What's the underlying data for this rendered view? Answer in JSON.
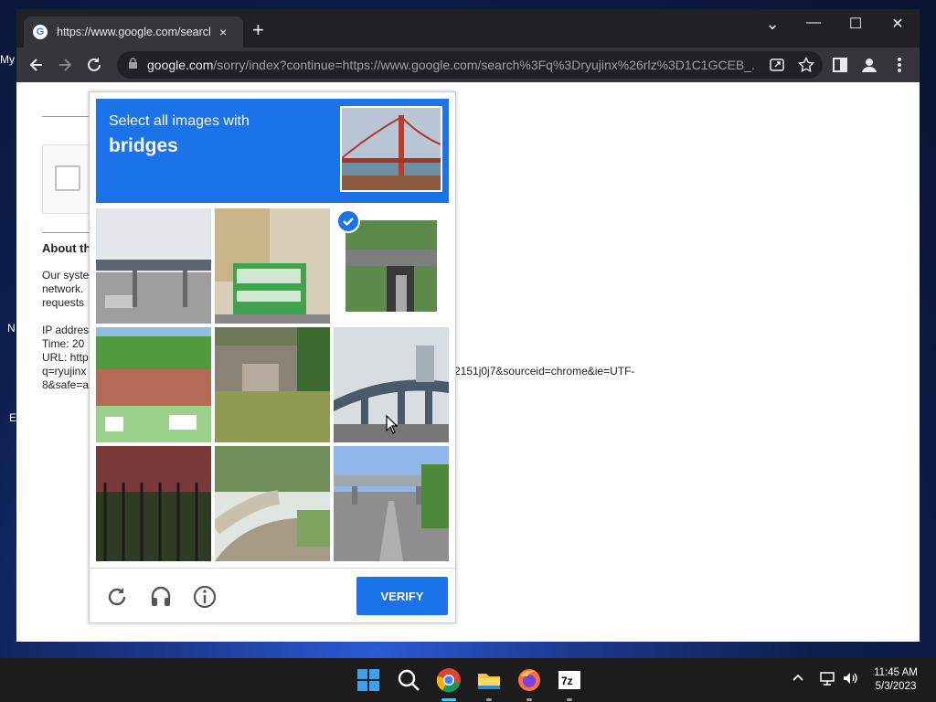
{
  "desktop": {
    "icon_label_stubs": [
      "My",
      "N",
      "E"
    ]
  },
  "browser": {
    "tab": {
      "title": "https://www.google.com/search?",
      "favicon": "G",
      "close": "×"
    },
    "new_tab": "+",
    "window_controls": {
      "dropdown": "⌄",
      "minimize": "—",
      "maximize": "☐",
      "close": "✕"
    },
    "address": {
      "domain": "google.com",
      "path": "/sorry/index?continue=https://www.google.com/search%3Fq%3Dryujinx%26rlz%3D1C1GCEB_..."
    }
  },
  "page": {
    "about_heading": "About th",
    "paragraph_lines": [
      "Our syste",
      "network.",
      "requests"
    ],
    "info_lines": [
      "IP addres",
      "Time: 20",
      "URL: http",
      "q=ryujinx",
      "8&safe=a"
    ],
    "url_overflow": "2151j0j7&sourceid=chrome&ie=UTF-"
  },
  "captcha": {
    "prompt": "Select all images with",
    "target": "bridges",
    "verify_label": "VERIFY",
    "tiles_selected": [
      false,
      false,
      true,
      false,
      false,
      false,
      false,
      false,
      false
    ]
  },
  "taskbar": {
    "apps": [
      "start",
      "search",
      "chrome",
      "file-explorer",
      "firefox",
      "7zip"
    ],
    "time": "11:45 AM",
    "date": "5/3/2023"
  },
  "colors": {
    "accent": "#1a73e8",
    "chrome_dark": "#202124",
    "toolbar": "#35363a"
  }
}
